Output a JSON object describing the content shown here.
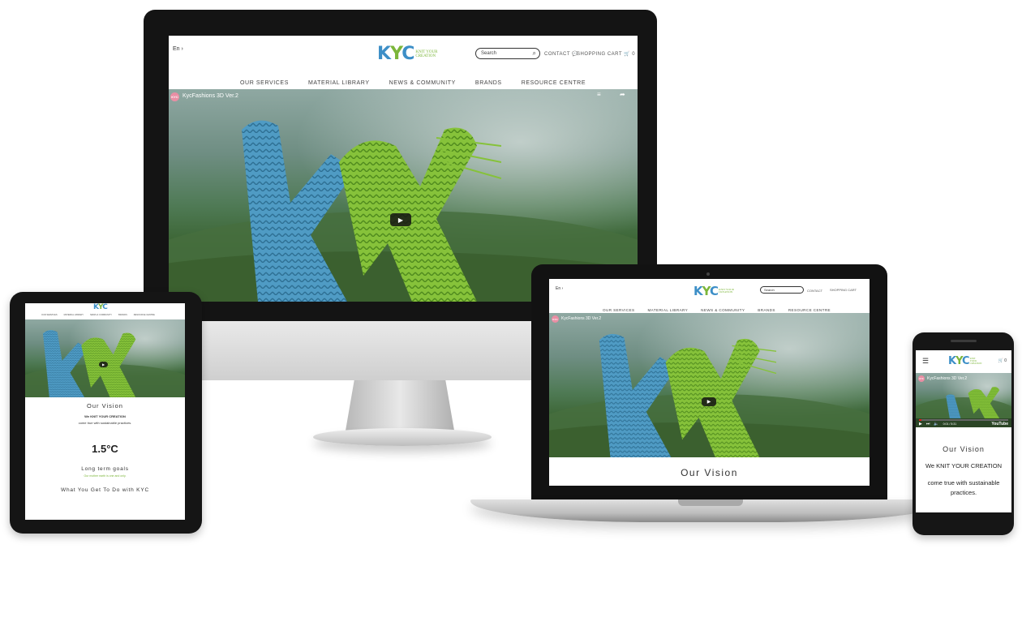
{
  "site": {
    "brand_letters": [
      "K",
      "Y",
      "C"
    ],
    "brand_subtitle": "KNIT YOUR CREATION",
    "lang": "En ›",
    "search_placeholder": "Search",
    "contact_label": "CONTACT",
    "cart_label": "SHOPPING CART",
    "cart_count": "0",
    "menu": [
      "OUR SERVICES",
      "MATERIAL LIBRARY",
      "NEWS & COMMUNITY",
      "BRANDS",
      "RESOURCE CENTRE"
    ],
    "video_title": "KycFashions 3D Ver.2",
    "video_badge": "KYC",
    "colors": {
      "brand_blue": "#3d8fc7",
      "brand_green": "#7cb63a",
      "accent_orange": "#d89a2b",
      "youtube_red": "#e62117"
    }
  },
  "laptop": {
    "section_title": "Our Vision"
  },
  "tablet": {
    "section_title": "Our Vision",
    "knit_line": "We KNIT YOUR CREATION",
    "come_line": "come true with sustainable practices.",
    "temp_value": "1.5°C",
    "goals_title": "Long term goals",
    "goals_sub": "Our mother earth is one and only.",
    "what_title": "What You Get To Do with KYC"
  },
  "phone": {
    "section_title": "Our Vision",
    "knit_line": "We KNIT YOUR CREATION",
    "come_line": "come true with sustainable practices.",
    "video_time": "0:01 / 5:31",
    "youtube_label": "YouTube",
    "progress": 0.03
  },
  "icons": {
    "search": "search-icon",
    "contact": "chat-bubble-icon",
    "cart": "cart-icon",
    "play": "play-icon",
    "menu": "hamburger-menu-icon",
    "share": "share-icon",
    "playlist": "playlist-icon"
  }
}
